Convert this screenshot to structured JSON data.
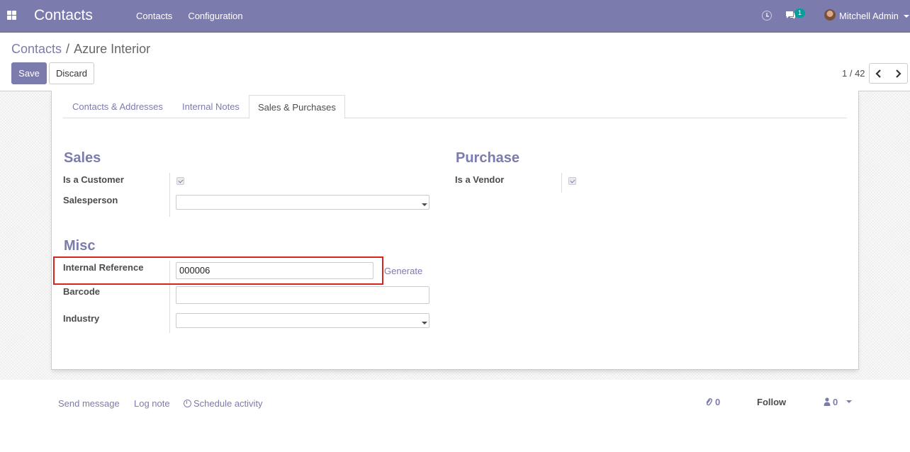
{
  "navbar": {
    "app_title": "Contacts",
    "menu": [
      "Contacts",
      "Configuration"
    ],
    "messages_badge": "1",
    "user_name": "Mitchell Admin",
    "color": "#7c7bad"
  },
  "breadcrumb": {
    "parent": "Contacts",
    "separator": "/",
    "current": "Azure Interior"
  },
  "buttons": {
    "save": "Save",
    "discard": "Discard"
  },
  "pager": {
    "value": "1 / 42"
  },
  "tabs": [
    {
      "label": "Contacts & Addresses",
      "active": false
    },
    {
      "label": "Internal Notes",
      "active": false
    },
    {
      "label": "Sales & Purchases",
      "active": true
    }
  ],
  "sales": {
    "title": "Sales",
    "is_customer_label": "Is a Customer",
    "is_customer": true,
    "salesperson_label": "Salesperson",
    "salesperson_value": ""
  },
  "purchase": {
    "title": "Purchase",
    "is_vendor_label": "Is a Vendor",
    "is_vendor": true
  },
  "misc": {
    "title": "Misc",
    "internal_reference_label": "Internal Reference",
    "internal_reference_value": "000006",
    "generate_link": "Generate",
    "barcode_label": "Barcode",
    "barcode_value": "",
    "industry_label": "Industry",
    "industry_value": ""
  },
  "chatter": {
    "send_message": "Send message",
    "log_note": "Log note",
    "schedule_activity": "Schedule activity",
    "attachments_count": "0",
    "follow": "Follow",
    "followers_count": "0"
  }
}
